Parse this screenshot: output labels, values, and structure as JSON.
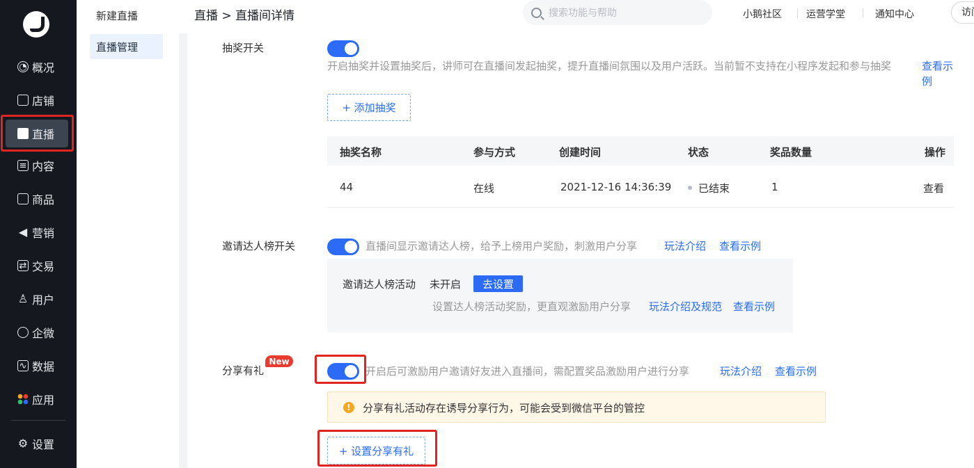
{
  "nav": {
    "items": [
      {
        "label": "概况",
        "icon": "chart-icon"
      },
      {
        "label": "店铺",
        "icon": "store-icon"
      },
      {
        "label": "直播",
        "icon": "video-icon"
      },
      {
        "label": "内容",
        "icon": "document-icon"
      },
      {
        "label": "商品",
        "icon": "box-icon"
      },
      {
        "label": "营销",
        "icon": "megaphone-icon"
      },
      {
        "label": "交易",
        "icon": "exchange-icon"
      },
      {
        "label": "用户",
        "icon": "user-icon"
      },
      {
        "label": "企微",
        "icon": "wecom-icon"
      },
      {
        "label": "数据",
        "icon": "data-icon"
      },
      {
        "label": "应用",
        "icon": "apps-icon"
      },
      {
        "label": "设置",
        "icon": "gear-icon"
      }
    ],
    "active": "直播"
  },
  "subnav": {
    "items": [
      {
        "label": "新建直播"
      },
      {
        "label": "直播管理"
      }
    ],
    "active": "直播管理"
  },
  "header": {
    "breadcrumb": "直播 > 直播间详情",
    "search_placeholder": "搜索功能与帮助",
    "links": [
      "小鹅社区",
      "运营学堂",
      "通知中心"
    ],
    "visit_label": "访问"
  },
  "lottery": {
    "label": "抽奖开关",
    "enabled": true,
    "description": "开启抽奖并设置抽奖后，讲师可在直播间发起抽奖，提升直播间氛围以及用户活跃。当前暂不支持在小程序发起和参与抽奖",
    "example_link": "查看示例",
    "add_button": "+ 添加抽奖",
    "table": {
      "headers": [
        "抽奖名称",
        "参与方式",
        "创建时间",
        "状态",
        "奖品数量",
        "操作"
      ],
      "rows": [
        {
          "name": "44",
          "method": "在线",
          "created": "2021-12-16 14:36:39",
          "status": "已结束",
          "prizes": "1",
          "action": "查看"
        }
      ]
    }
  },
  "invite": {
    "label": "邀请达人榜开关",
    "enabled": true,
    "description": "直播间显示邀请达人榜，给予上榜用户奖励，刺激用户分享",
    "rules_link": "玩法介绍",
    "example_link": "查看示例",
    "box": {
      "activity_label": "邀请达人榜活动",
      "status": "未开启",
      "set_button": "去设置",
      "hint": "设置达人榜活动奖励，更直观激励用户分享",
      "rules_link": "玩法介绍及规范",
      "example_link": "查看示例"
    }
  },
  "share": {
    "label": "分享有礼",
    "badge": "New",
    "enabled": true,
    "description": "开启后可激励用户邀请好友进入直播间，需配置奖品激励用户进行分享",
    "rules_link": "玩法介绍",
    "example_link": "查看示例",
    "warning": "分享有礼活动存在诱导分享行为，可能会受到微信平台的管控",
    "set_button": "+ 设置分享有礼"
  },
  "colors": {
    "primary": "#2b6bf6",
    "nav_bg": "#15191f",
    "highlight_red": "#e0241f",
    "badge_red": "#e93b2f",
    "warning_bg": "#fff7e8"
  }
}
